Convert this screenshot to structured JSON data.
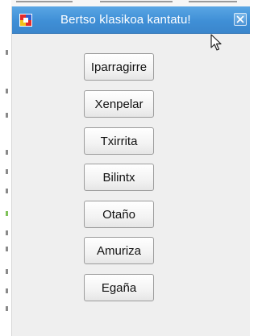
{
  "window": {
    "title": "Bertso klasikoa kantatu!",
    "close_icon": "close-icon",
    "app_icon": "app-icon"
  },
  "buttons": [
    {
      "label": "Iparragirre"
    },
    {
      "label": "Xenpelar"
    },
    {
      "label": "Txirrita"
    },
    {
      "label": "Bilintx"
    },
    {
      "label": "Otaño"
    },
    {
      "label": "Amuriza"
    },
    {
      "label": "Egaña"
    }
  ],
  "colors": {
    "titlebar": "#4a94da",
    "window_bg": "#efefef",
    "button_border": "#9c9c9c"
  }
}
